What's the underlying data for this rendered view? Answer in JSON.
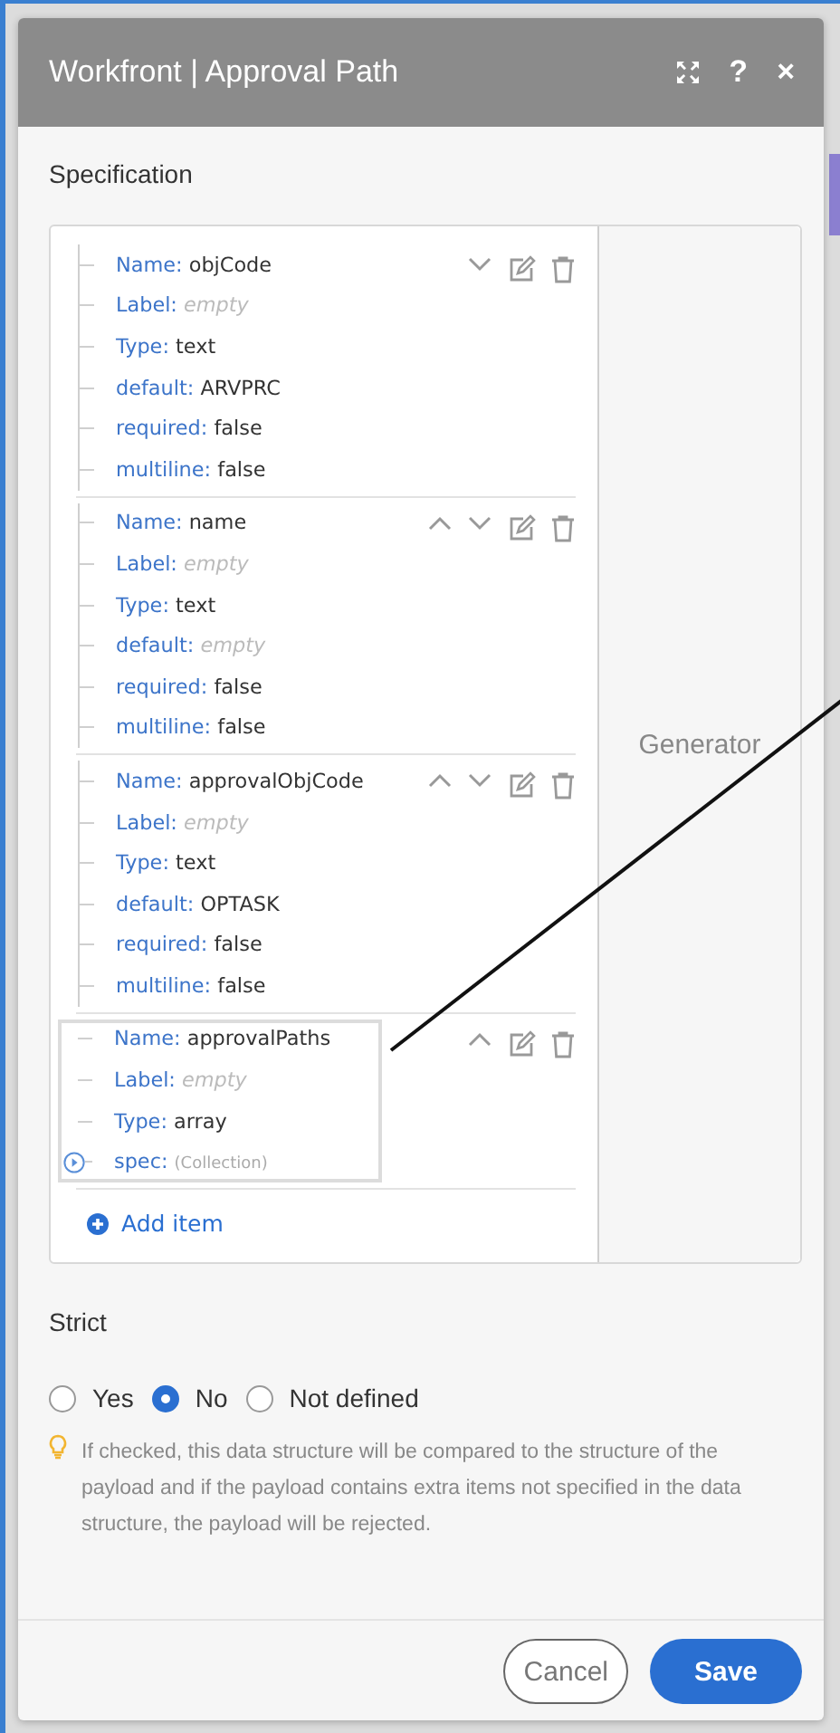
{
  "window": {
    "title": "Workfront | Approval Path",
    "help": "?",
    "close": "×"
  },
  "section_title": "Specification",
  "fields": [
    {
      "move_up": false,
      "move_down": true,
      "highlighted": false,
      "props": [
        {
          "key": "Name:",
          "value": "objCode",
          "kind": "text"
        },
        {
          "key": "Label:",
          "value": "empty",
          "kind": "empty"
        },
        {
          "key": "Type:",
          "value": "text",
          "kind": "text"
        },
        {
          "key": "default:",
          "value": "ARVPRC",
          "kind": "text"
        },
        {
          "key": "required:",
          "value": "false",
          "kind": "text"
        },
        {
          "key": "multiline:",
          "value": "false",
          "kind": "text"
        }
      ]
    },
    {
      "move_up": true,
      "move_down": true,
      "highlighted": false,
      "props": [
        {
          "key": "Name:",
          "value": "name",
          "kind": "text"
        },
        {
          "key": "Label:",
          "value": "empty",
          "kind": "empty"
        },
        {
          "key": "Type:",
          "value": "text",
          "kind": "text"
        },
        {
          "key": "default:",
          "value": "empty",
          "kind": "empty"
        },
        {
          "key": "required:",
          "value": "false",
          "kind": "text"
        },
        {
          "key": "multiline:",
          "value": "false",
          "kind": "text"
        }
      ]
    },
    {
      "move_up": true,
      "move_down": true,
      "highlighted": false,
      "props": [
        {
          "key": "Name:",
          "value": "approvalObjCode",
          "kind": "text"
        },
        {
          "key": "Label:",
          "value": "empty",
          "kind": "empty"
        },
        {
          "key": "Type:",
          "value": "text",
          "kind": "text"
        },
        {
          "key": "default:",
          "value": "OPTASK",
          "kind": "text"
        },
        {
          "key": "required:",
          "value": "false",
          "kind": "text"
        },
        {
          "key": "multiline:",
          "value": "false",
          "kind": "text"
        }
      ]
    },
    {
      "move_up": true,
      "move_down": false,
      "highlighted": true,
      "props": [
        {
          "key": "Name:",
          "value": "approvalPaths",
          "kind": "text"
        },
        {
          "key": "Label:",
          "value": "empty",
          "kind": "empty"
        },
        {
          "key": "Type:",
          "value": "array",
          "kind": "text"
        },
        {
          "key": "spec:",
          "value": "(Collection)",
          "kind": "collection"
        }
      ]
    }
  ],
  "add_item": "Add item",
  "generator": "Generator",
  "strict": {
    "label": "Strict",
    "options": [
      {
        "label": "Yes",
        "selected": false
      },
      {
        "label": "No",
        "selected": true
      },
      {
        "label": "Not defined",
        "selected": false
      }
    ]
  },
  "hint": "If checked, this data structure will be compared to the structure of the payload and if the payload contains extra items not specified in the data structure, the payload will be rejected.",
  "buttons": {
    "cancel": "Cancel",
    "save": "Save"
  }
}
